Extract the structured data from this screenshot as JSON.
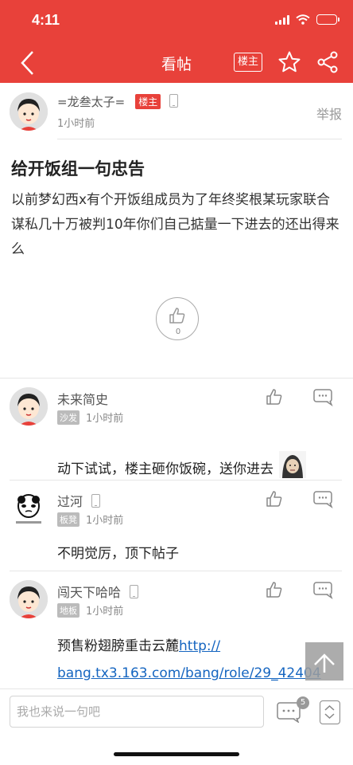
{
  "status": {
    "time": "4:11"
  },
  "nav": {
    "title": "看帖",
    "louzhu_button": "楼主"
  },
  "post": {
    "author": "=龙叁太子=",
    "author_badge": "楼主",
    "time": "1小时前",
    "report": "举报",
    "title": "给开饭组一句忠告",
    "body": "以前梦幻西x有个开饭组成员为了年终奖根某玩家联合谋私几十万被判10年你们自己掂量一下进去的还出得来么",
    "likes": "0"
  },
  "comments": [
    {
      "name": "未来简史",
      "floor": "沙发",
      "time": "1小时前",
      "text": "动下试试，楼主砸你饭碗，送你进去"
    },
    {
      "name": "过河",
      "floor": "板凳",
      "time": "1小时前",
      "text": "不明觉厉，顶下帖子"
    },
    {
      "name": "闯天下哈哈",
      "floor": "地板",
      "time": "1小时前",
      "text": "预售粉翅膀重击云麓",
      "link_line1": "http://",
      "link_line2": "bang.tx3.163.com/bang/role/29_42404"
    }
  ],
  "bottom": {
    "input_placeholder": "我也来说一句吧",
    "comment_count": "5"
  },
  "colors": {
    "brand": "#e8413a",
    "link": "#1565c0"
  }
}
